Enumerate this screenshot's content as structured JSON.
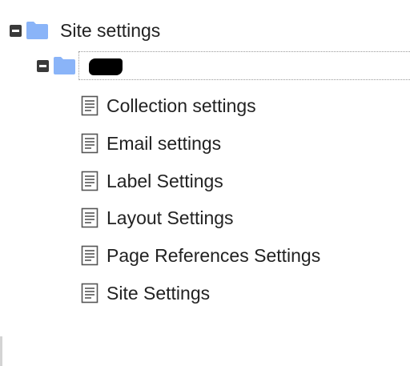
{
  "tree": {
    "root": {
      "label": "Site settings",
      "icon": "folder-icon",
      "toggle": "collapse-icon"
    },
    "child": {
      "label": "",
      "redacted": true,
      "icon": "folder-icon",
      "toggle": "collapse-icon"
    },
    "items": [
      {
        "label": "Collection settings",
        "icon": "document-icon"
      },
      {
        "label": "Email settings",
        "icon": "document-icon"
      },
      {
        "label": "Label Settings",
        "icon": "document-icon"
      },
      {
        "label": "Layout Settings",
        "icon": "document-icon"
      },
      {
        "label": "Page References Settings",
        "icon": "document-icon"
      },
      {
        "label": "Site Settings",
        "icon": "document-icon"
      }
    ]
  },
  "colors": {
    "folder": "#8ab4f8",
    "toggle": "#3a3a3a",
    "text": "#222222"
  }
}
